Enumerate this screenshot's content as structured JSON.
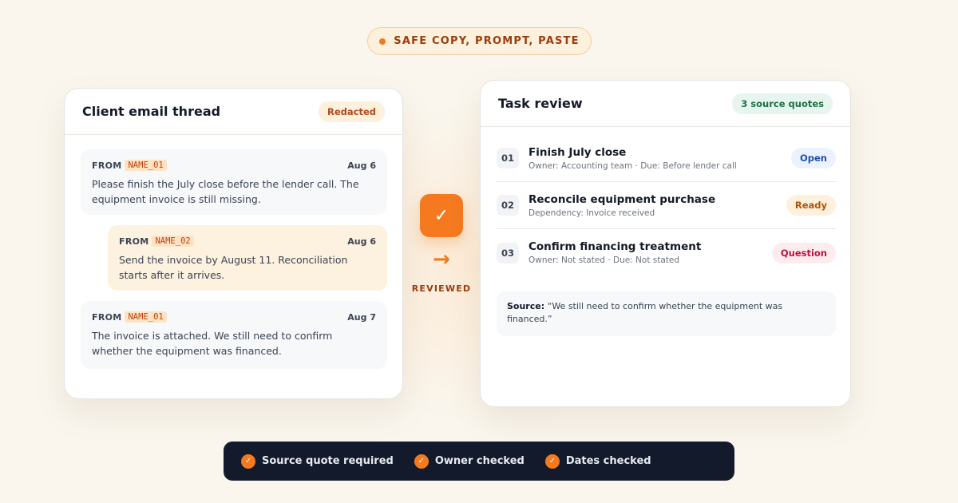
{
  "top_pill": {
    "label": "SAFE COPY, PROMPT, PASTE",
    "dot_color": "#f07a1c"
  },
  "email_thread": {
    "title": "Client email thread",
    "badge": "Redacted",
    "messages": [
      {
        "from_label": "FROM",
        "sender": "NAME_01",
        "date": "Aug 6",
        "body": "Please finish the July close before the lender call. The equipment invoice is still missing.",
        "style": "grey"
      },
      {
        "from_label": "FROM",
        "sender": "NAME_02",
        "date": "Aug 6",
        "body": "Send the invoice by August 11. Reconciliation starts after it arrives.",
        "style": "orange"
      },
      {
        "from_label": "FROM",
        "sender": "NAME_01",
        "date": "Aug 7",
        "body": "The invoice is attached. We still need to confirm whether the equipment was financed.",
        "style": "grey"
      }
    ]
  },
  "middle": {
    "check_icon": "✓",
    "arrow_icon": "→",
    "label": "REVIEWED",
    "accent": "#f57a1f"
  },
  "task_review": {
    "title": "Task review",
    "badge": "3 source quotes",
    "tasks": [
      {
        "num": "01",
        "title": "Finish July close",
        "meta": "Owner: Accounting team · Due: Before lender call",
        "status": "Open"
      },
      {
        "num": "02",
        "title": "Reconcile equipment purchase",
        "meta": "Dependency: Invoice received",
        "status": "Ready"
      },
      {
        "num": "03",
        "title": "Confirm financing treatment",
        "meta": "Owner: Not stated · Due: Not stated",
        "status": "Question"
      }
    ],
    "source": {
      "label": "Source:",
      "quote": "“We still need to confirm whether the equipment was financed.”"
    }
  },
  "checks": [
    {
      "icon": "✓",
      "label": "Source quote required"
    },
    {
      "icon": "✓",
      "label": "Owner checked"
    },
    {
      "icon": "✓",
      "label": "Dates checked"
    }
  ],
  "colors": {
    "background": "#faf6ee",
    "accent_orange": "#f57a1f",
    "bottom_bar": "#121a2b",
    "status_open": "#1d4fb0",
    "status_ready": "#b45309",
    "status_question": "#be123c"
  }
}
